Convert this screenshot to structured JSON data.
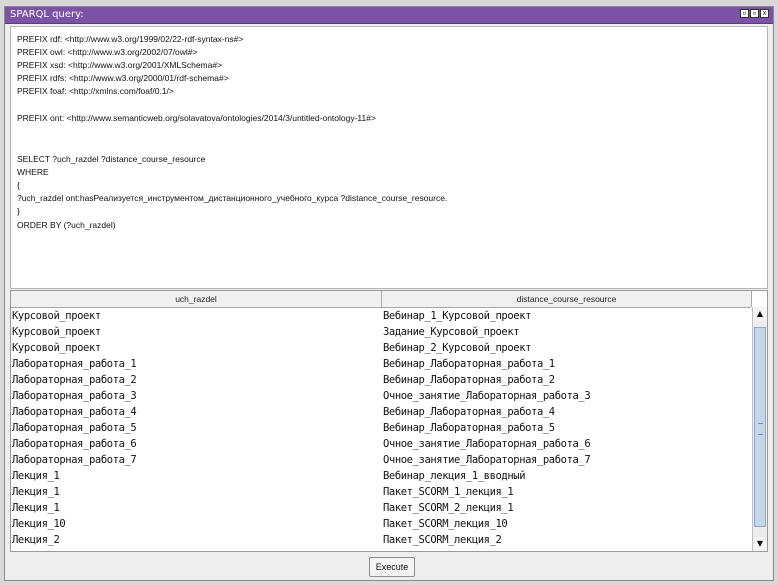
{
  "window": {
    "title": "SPARQL query:",
    "buttons": [
      "▫",
      "▫",
      "x"
    ]
  },
  "query": {
    "lines": [
      "PREFIX rdf: <http://www.w3.org/1999/02/22-rdf-syntax-ns#>",
      "PREFIX owl: <http://www.w3.org/2002/07/owl#>",
      "PREFIX xsd: <http://www.w3.org/2001/XMLSchema#>",
      "PREFIX rdfs: <http://www.w3.org/2000/01/rdf-schema#>",
      "PREFIX foaf: <http://xmlns.com/foaf/0.1/>",
      "",
      "PREFIX ont: <http://www.semanticweb.org/solavatova/ontologies/2014/3/untitled-ontology-11#>",
      "",
      "",
      "SELECT ?uch_razdel ?distance_course_resource",
      "WHERE",
      "{",
      "?uch_razdel ont:hasРеализуется_инструментом_дистанционного_учебного_курса ?distance_course_resource.",
      "}",
      "ORDER BY (?uch_razdel)"
    ]
  },
  "results": {
    "columns": [
      "uch_razdel",
      "distance_course_resource"
    ],
    "rows": [
      [
        "Курсовой_проект",
        "Вебинар_1_Курсовой_проект"
      ],
      [
        "Курсовой_проект",
        "Задание_Курсовой_проект"
      ],
      [
        "Курсовой_проект",
        "Вебинар_2_Курсовой_проект"
      ],
      [
        "Лабораторная_работа_1",
        "Вебинар_Лабораторная_работа_1"
      ],
      [
        "Лабораторная_работа_2",
        "Вебинар_Лабораторная_работа_2"
      ],
      [
        "Лабораторная_работа_3",
        "Очное_занятие_Лабораторная_работа_3"
      ],
      [
        "Лабораторная_работа_4",
        "Вебинар_Лабораторная_работа_4"
      ],
      [
        "Лабораторная_работа_5",
        "Вебинар_Лабораторная_работа_5"
      ],
      [
        "Лабораторная_работа_6",
        "Очное_занятие_Лабораторная_работа_6"
      ],
      [
        "Лабораторная_работа_7",
        "Очное_занятие_Лабораторная_работа_7"
      ],
      [
        "Лекция_1",
        "Вебинар_лекция_1_вводный"
      ],
      [
        "Лекция_1",
        "Пакет_SCORM_1_лекция_1"
      ],
      [
        "Лекция_1",
        "Пакет_SCORM_2_лекция_1"
      ],
      [
        "Лекция_10",
        "Пакет_SCORM_лекция_10"
      ],
      [
        "Лекция_2",
        "Пакет_SCORM_лекция_2"
      ]
    ]
  },
  "scrollbar": {
    "up_arrow": "▲",
    "down_arrow": "▼"
  },
  "execute_label": "Execute",
  "colors": {
    "titlebar": "#7b52a6",
    "thumb": "#c6d6ea"
  }
}
